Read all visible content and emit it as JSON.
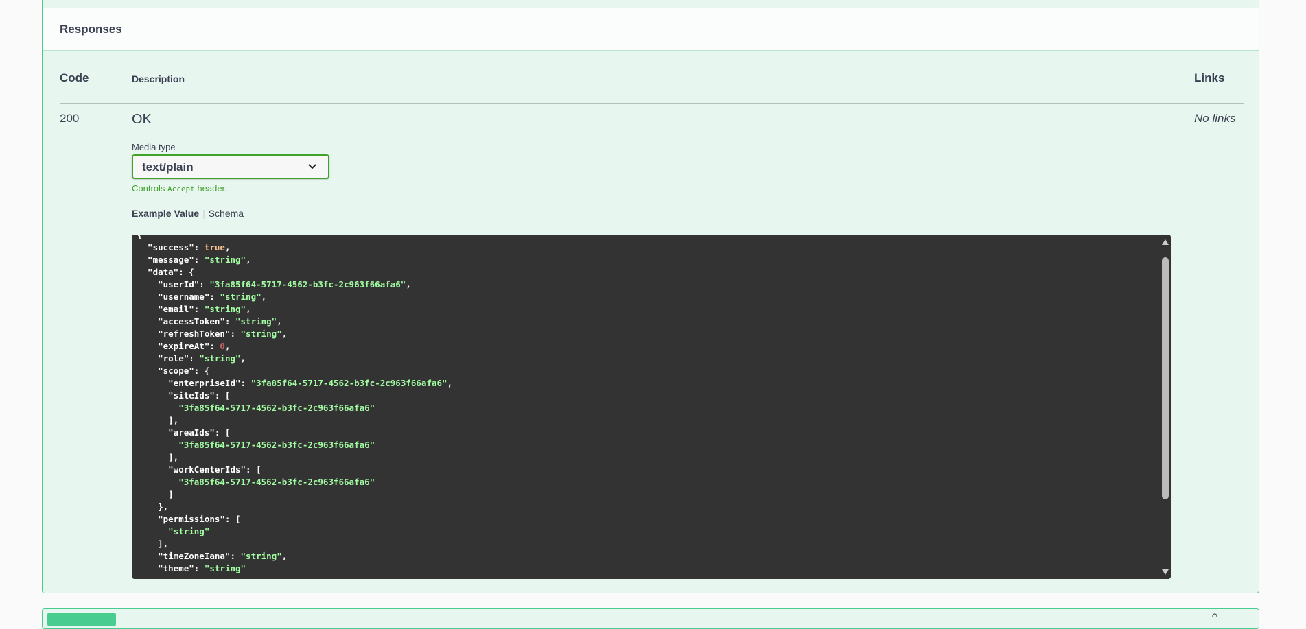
{
  "responses": {
    "title": "Responses",
    "columns": {
      "code": "Code",
      "description": "Description",
      "links": "Links"
    },
    "rows": [
      {
        "code": "200",
        "description": "OK",
        "links": "No links",
        "media_type_label": "Media type",
        "media_type_value": "text/plain",
        "controls_prefix": "Controls ",
        "controls_code": "Accept",
        "controls_suffix": " header.",
        "tab_example": "Example Value",
        "tab_schema": "Schema"
      }
    ]
  },
  "example_lines": [
    [
      [
        "p",
        "{"
      ]
    ],
    [
      [
        "p",
        "  \"success\": "
      ],
      [
        "b",
        "true"
      ],
      [
        "p",
        ","
      ]
    ],
    [
      [
        "p",
        "  \"message\": "
      ],
      [
        "s",
        "\"string\""
      ],
      [
        "p",
        ","
      ]
    ],
    [
      [
        "p",
        "  \"data\": {"
      ]
    ],
    [
      [
        "p",
        "    \"userId\": "
      ],
      [
        "s",
        "\"3fa85f64-5717-4562-b3fc-2c963f66afa6\""
      ],
      [
        "p",
        ","
      ]
    ],
    [
      [
        "p",
        "    \"username\": "
      ],
      [
        "s",
        "\"string\""
      ],
      [
        "p",
        ","
      ]
    ],
    [
      [
        "p",
        "    \"email\": "
      ],
      [
        "s",
        "\"string\""
      ],
      [
        "p",
        ","
      ]
    ],
    [
      [
        "p",
        "    \"accessToken\": "
      ],
      [
        "s",
        "\"string\""
      ],
      [
        "p",
        ","
      ]
    ],
    [
      [
        "p",
        "    \"refreshToken\": "
      ],
      [
        "s",
        "\"string\""
      ],
      [
        "p",
        ","
      ]
    ],
    [
      [
        "p",
        "    \"expireAt\": "
      ],
      [
        "n",
        "0"
      ],
      [
        "p",
        ","
      ]
    ],
    [
      [
        "p",
        "    \"role\": "
      ],
      [
        "s",
        "\"string\""
      ],
      [
        "p",
        ","
      ]
    ],
    [
      [
        "p",
        "    \"scope\": {"
      ]
    ],
    [
      [
        "p",
        "      \"enterpriseId\": "
      ],
      [
        "s",
        "\"3fa85f64-5717-4562-b3fc-2c963f66afa6\""
      ],
      [
        "p",
        ","
      ]
    ],
    [
      [
        "p",
        "      \"siteIds\": ["
      ]
    ],
    [
      [
        "s",
        "        \"3fa85f64-5717-4562-b3fc-2c963f66afa6\""
      ]
    ],
    [
      [
        "p",
        "      ],"
      ]
    ],
    [
      [
        "p",
        "      \"areaIds\": ["
      ]
    ],
    [
      [
        "s",
        "        \"3fa85f64-5717-4562-b3fc-2c963f66afa6\""
      ]
    ],
    [
      [
        "p",
        "      ],"
      ]
    ],
    [
      [
        "p",
        "      \"workCenterIds\": ["
      ]
    ],
    [
      [
        "s",
        "        \"3fa85f64-5717-4562-b3fc-2c963f66afa6\""
      ]
    ],
    [
      [
        "p",
        "      ]"
      ]
    ],
    [
      [
        "p",
        "    },"
      ]
    ],
    [
      [
        "p",
        "    \"permissions\": ["
      ]
    ],
    [
      [
        "s",
        "      \"string\""
      ]
    ],
    [
      [
        "p",
        "    ],"
      ]
    ],
    [
      [
        "p",
        "    \"timeZoneIana\": "
      ],
      [
        "s",
        "\"string\""
      ],
      [
        "p",
        ","
      ]
    ],
    [
      [
        "p",
        "    \"theme\": "
      ],
      [
        "s",
        "\"string\""
      ]
    ]
  ],
  "icons": {
    "select_arrow": "chevron-down-icon",
    "scroll_up": "arrow-up-icon",
    "scroll_down": "arrow-down-icon",
    "next_lock": "lock-icon"
  },
  "colors": {
    "accent_green": "#49cc90",
    "select_border": "#41a229",
    "block_bg": "#e8f6f0",
    "code_bg": "#333333",
    "string": "#a2fca2",
    "boolean": "#fcc28c",
    "number": "#d36363"
  }
}
